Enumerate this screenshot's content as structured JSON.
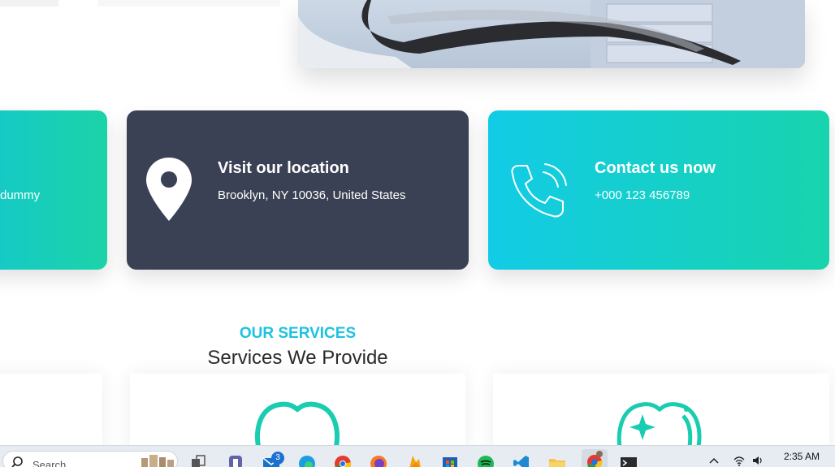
{
  "cards": {
    "left_partial_text": "dummy",
    "location": {
      "title": "Visit our location",
      "subtitle": "Brooklyn, NY 10036, United States"
    },
    "contact": {
      "title": "Contact us now",
      "subtitle": "+000 123 456789"
    }
  },
  "services": {
    "label": "OUR SERVICES",
    "title": "Services We Provide"
  },
  "taskbar": {
    "search_placeholder": "Search",
    "mail_badge": "3",
    "clock": "2:35 AM",
    "apps": [
      "task-view-icon",
      "teams-icon",
      "mail-icon",
      "edge-icon",
      "chrome-icon",
      "firefox-icon",
      "firebase-icon",
      "store-icon",
      "spotify-icon",
      "vscode-icon",
      "file-explorer-icon",
      "chrome-profile-icon",
      "terminal-icon"
    ]
  },
  "colors": {
    "accent_cyan": "#12cbe6",
    "accent_teal": "#18d4ad",
    "dark_card": "#3a4154",
    "services_label": "#1ec2e0"
  }
}
